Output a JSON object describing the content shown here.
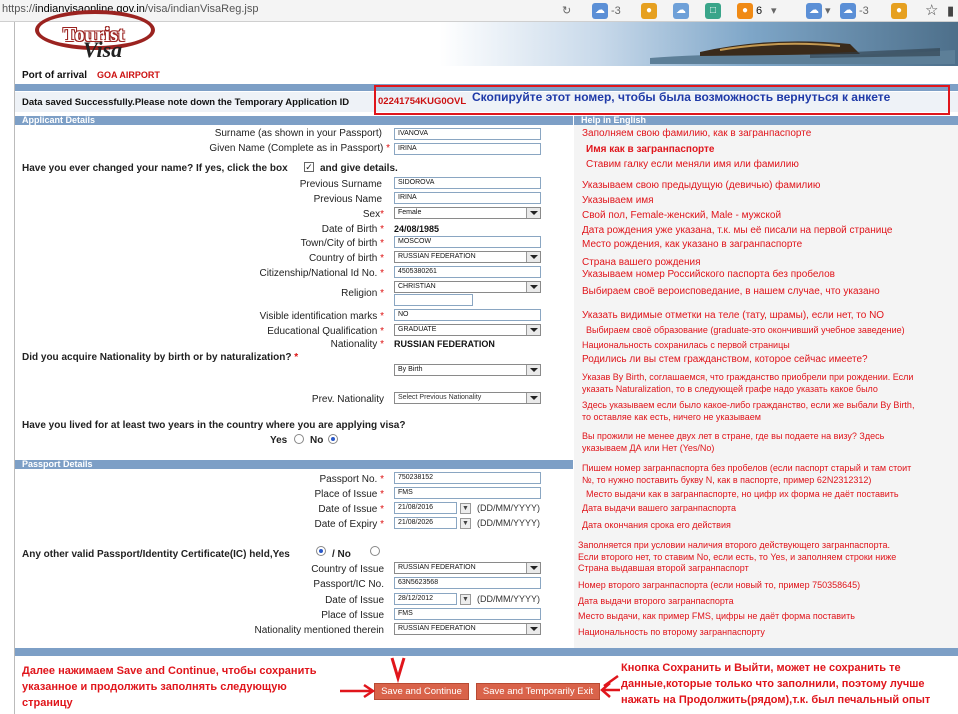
{
  "browser": {
    "url_prefix": "https://",
    "url_host": "indianvisaonline.gov.in",
    "url_path": "/visa/indianVisaReg.jsp",
    "weather_1": "-3",
    "badge_count": "6",
    "weather_2": "-3"
  },
  "header": {
    "logo_top": "Tourist",
    "logo_bottom": "Visa",
    "port_label": "Port of arrival",
    "port_value": "GOA AIRPORT"
  },
  "saved": {
    "message": "Data saved Successfully.Please note down the Temporary Application ID",
    "temp_id": "02241754KUG0OVL",
    "annotation": "Скопируйте этот номер, чтобы была возможность вернуться к анкете"
  },
  "sections": {
    "applicant": "Applicant Details",
    "help": "Help in English",
    "passport": "Passport Details"
  },
  "applicant": {
    "surname_label": "Surname (as shown in your Passport)",
    "surname": "IVANOVA",
    "given_label": "Given Name (Complete as in Passport)",
    "given": "IRINA",
    "changed_q": "Have you ever changed your name? If yes, click the box",
    "changed_q2": "and give details.",
    "prev_surname_label": "Previous Surname",
    "prev_surname": "SIDOROVA",
    "prev_name_label": "Previous Name",
    "prev_name": "IRINA",
    "sex_label": "Sex",
    "sex": "Female",
    "dob_label": "Date of Birth",
    "dob": "24/08/1985",
    "town_label": "Town/City of birth",
    "town": "MOSCOW",
    "country_label": "Country of birth",
    "country": "RUSSIAN FEDERATION",
    "citizen_label": "Citizenship/National Id No.",
    "citizen": "4505380261",
    "religion_label": "Religion",
    "religion": "CHRISTIAN",
    "marks_label": "Visible identification marks",
    "marks": "NO",
    "edu_label": "Educational Qualification",
    "edu": "GRADUATE",
    "nationality_label": "Nationality",
    "nationality": "RUSSIAN FEDERATION",
    "acquire_q": "Did you acquire Nationality by birth or by naturalization?",
    "acquire": "By Birth",
    "prev_nat_label": "Prev. Nationality",
    "prev_nat": "Select Previous Nationality",
    "lived_q": "Have you lived for at least two years in the country where you are applying visa?",
    "yes": "Yes",
    "no": "No"
  },
  "passport": {
    "no_label": "Passport No.",
    "no": "750238152",
    "place_label": "Place of Issue",
    "place": "FMS",
    "issue_label": "Date of Issue",
    "issue": "21/08/2016",
    "expiry_label": "Date of Expiry",
    "expiry": "21/08/2026",
    "date_fmt": "(DD/MM/YYYY)",
    "other_q": "Any other valid Passport/Identity Certificate(IC) held,Yes",
    "other_no": "/ No",
    "country_label": "Country of Issue",
    "country": "RUSSIAN FEDERATION",
    "ic_label": "Passport/IC No.",
    "ic": "63N5623568",
    "issue2_label": "Date of Issue",
    "issue2": "28/12/2012",
    "place2_label": "Place of Issue",
    "place2": "FMS",
    "nat_label": "Nationality mentioned therein",
    "nat": "RUSSIAN FEDERATION"
  },
  "help": {
    "h1": "Заполняем свою фамилию, как в загранпаспорте",
    "h2": "Имя как в загранпаспорте",
    "h3": "Ставим галку если меняли имя или фамилию",
    "h4": "Указываем свою предыдущую (девичью) фамилию",
    "h5": "Указываем имя",
    "h6": "Свой пол, Female-женский, Male - мужской",
    "h7": "Дата рождения уже указана, т.к. мы её писали на первой странице",
    "h8": "Место рождения, как указано в загранпаспорте",
    "h9": "Страна вашего рождения",
    "h10": "Указываем номер Российского паспорта без пробелов",
    "h11": "Выбираем своё вероисповедание, в нашем случае, что указано",
    "h12": "Указать видимые отметки на теле (тату, шрамы), если нет, то NO",
    "h13": "Выбираем своё образование (graduate-это окончивший учебное заведение)",
    "h14": "Национальность сохранилась с первой страницы",
    "h15": "Родились ли вы стем гражданством, которое сейчас имеете?",
    "h16a": "Указав By Birth, соглашаемся, что гражданство приобрели при рождении. Если",
    "h16b": "указать Naturalization, то в следующей графе надо указать какое было",
    "h17a": "Здесь указываем если было какое-либо гражданство, если же выбали  By Birth,",
    "h17b": "то оставляе как есть, ничего не указываем",
    "h18a": "Вы прожили не менее двух лет в стране, где вы подаете на визу? Здесь",
    "h18b": "указываем ДА или Нет (Yes/No)",
    "h19a": "Пишем номер загранпаспорта без пробелов (если паспорт старый и там стоит",
    "h19b": "№, то нужно поставить букву N, как в паспорте, пример 62N2312312)",
    "h20": "Место выдачи как в загранпаспорте, но цифр их форма не даёт поставить",
    "h21": "Дата выдачи вашего загранпаспорта",
    "h22": "Дата окончания срока его действия",
    "h23a": "Заполняется при условии наличия второго действующего загранпаспорта.",
    "h23b": "Если второго нет, то ставим No, если есть, то Yes, и заполняем строки ниже",
    "h24": "Страна выдавшая второй загранпаспорт",
    "h25": "Номер второго загранпаспорта (если новый то, пример 750358645)",
    "h26": "Дата выдачи второго загранпаспорта",
    "h27": "Место выдачи, как пример FMS, цифры не даёт форма поставить",
    "h28": "Национальность по второму загранпаспорту"
  },
  "footer": {
    "save_continue": "Save and Continue",
    "save_exit": "Save and Temporarily Exit",
    "note_left_1": "Далее нажимаем Save and Continue, чтобы сохранить",
    "note_left_2": "указанное и продолжить заполнять следующую",
    "note_left_3": "страницу",
    "note_right_1": "Кнопка Сохранить и Выйти, может не сохранить те",
    "note_right_2": "данные,которые только что заполнили, поэтому лучше",
    "note_right_3": "нажать на Продолжить(рядом),т.к. был печальный опыт"
  },
  "colors": {
    "section_bar": "#7d9fc6",
    "annotation_red": "#e0151b",
    "annotation_blue": "#1f3aa8",
    "button": "#d9634a"
  }
}
